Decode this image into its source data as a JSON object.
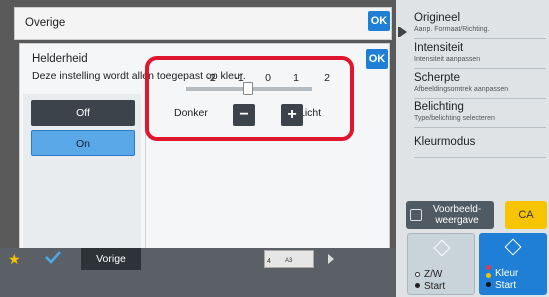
{
  "overige": {
    "title": "Overige",
    "ok_label": "OK"
  },
  "dialog": {
    "title": "Helderheid",
    "description": "Deze instelling wordt allen toegepast op kleur.",
    "ok_label": "OK",
    "options": [
      "Off",
      "On"
    ],
    "selected": "On",
    "slider": {
      "ticks": [
        "-2",
        "-1",
        "0",
        "1",
        "2"
      ],
      "value": 0,
      "left_label": "Donker",
      "right_label": "Licht",
      "minus_label": "−",
      "plus_label": "+"
    }
  },
  "right_panel": {
    "items": [
      {
        "title": "Origineel",
        "sub": "Aanp. Formaat/Richting."
      },
      {
        "title": "Intensiteit",
        "sub": "Intensiteit aanpassen"
      },
      {
        "title": "Scherpte",
        "sub": "Afbeeldingsomtrek aanpassen"
      },
      {
        "title": "Belichting",
        "sub": "Type/belichting selecteren"
      },
      {
        "title": "Kleurmodus",
        "sub": ""
      }
    ],
    "preview_label_1": "Voorbeeld-",
    "preview_label_2": "weergave",
    "ca_label": "CA",
    "start_bw_line1": "Z/W",
    "start_bw_line2": "Start",
    "start_color_line1": "Kleur",
    "start_color_line2": "Start"
  },
  "bottom": {
    "vorige_label": "Vorige",
    "tray_label": "A3",
    "tray_number": "4"
  },
  "colors": {
    "accent": "#1f7fd6",
    "highlight": "#e0152e",
    "ca": "#f6c400"
  }
}
